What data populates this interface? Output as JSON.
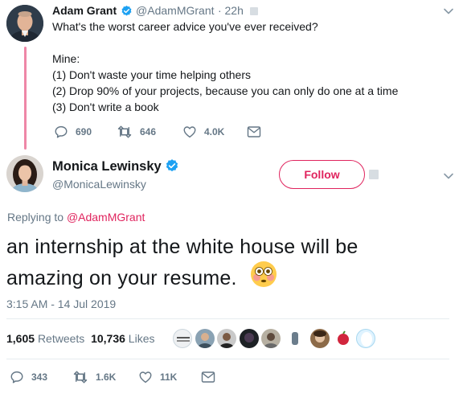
{
  "parent_tweet": {
    "author_name": "Adam Grant",
    "handle": "@AdamMGrant",
    "time": "· 22h",
    "lines": [
      "What's the worst career advice you've ever received?",
      "",
      "Mine:",
      "(1) Don't waste your time helping others",
      "(2) Drop 90% of your projects, because you can only do one at a time",
      "(3) Don't write a book"
    ],
    "replies": "690",
    "retweets": "646",
    "likes": "4.0K"
  },
  "reply_tweet": {
    "author_name": "Monica Lewinsky",
    "handle": "@MonicaLewinsky",
    "follow_label": "Follow",
    "replying_prefix": "Replying to",
    "replying_to": "@AdamMGrant",
    "text_line1": "an internship at the white house will be",
    "text_line2": "amazing on your resume.",
    "emoji": "flushed-face",
    "timestamp": "3:15 AM - 14 Jul 2019",
    "retweet_count": "1,605",
    "retweet_label": "Retweets",
    "like_count": "10,736",
    "like_label": "Likes",
    "replies": "343",
    "retweets": "1.6K",
    "likes": "11K"
  },
  "colors": {
    "accent": "#e0245e",
    "verified": "#1da1f2",
    "muted": "#657786",
    "text": "#14171a"
  }
}
